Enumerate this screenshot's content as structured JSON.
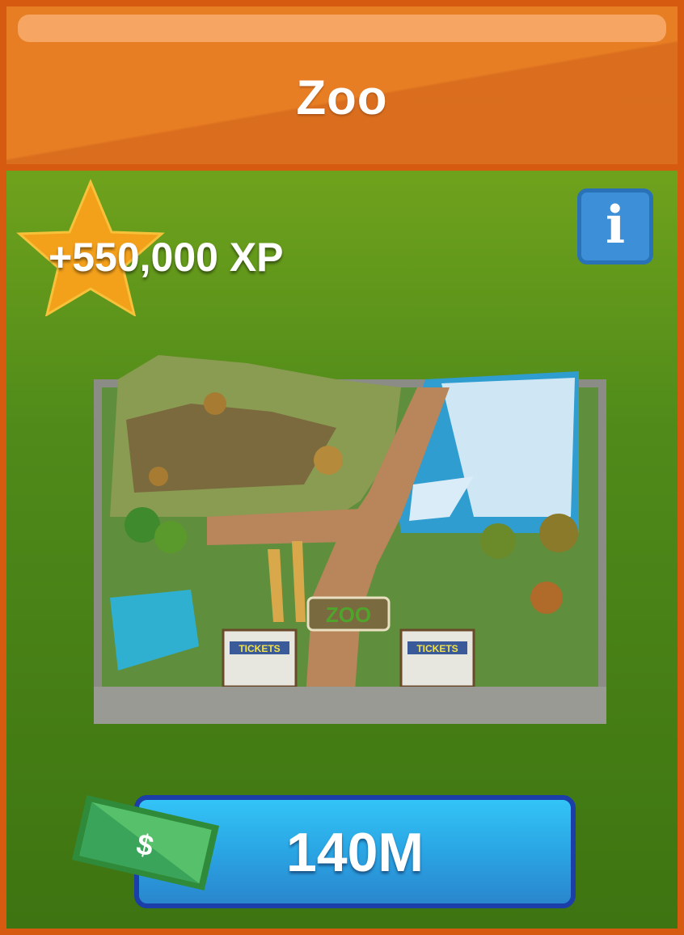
{
  "building": {
    "title": "Zoo",
    "xp_reward": "+550,000 XP",
    "price": "140M",
    "sign_text": "ZOO",
    "ticket_label": "TICKETS"
  },
  "icons": {
    "info": "i",
    "currency": "$"
  },
  "colors": {
    "header": "#e87e24",
    "border": "#d65a10",
    "panel_top": "#6fa21c",
    "panel_bottom": "#3e7411",
    "button": "#2aa5e4",
    "button_border": "#1b3ea8",
    "star": "#f3a01b",
    "info_button": "#3d8fd8",
    "bill": "#3aa55a"
  }
}
